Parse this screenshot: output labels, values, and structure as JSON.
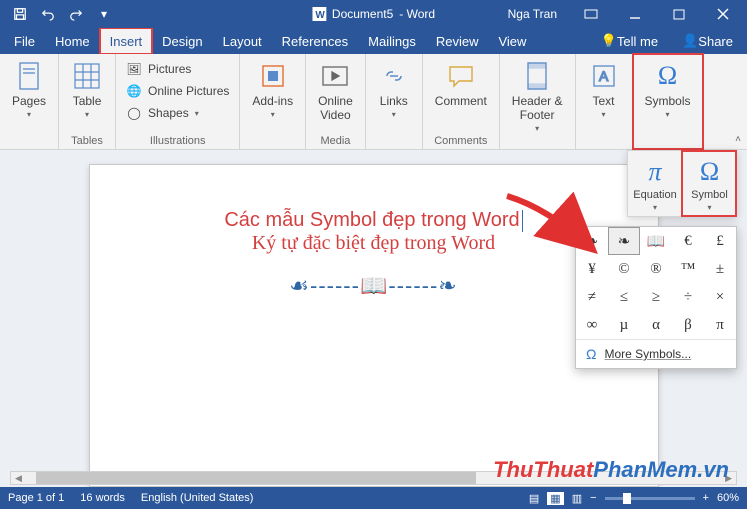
{
  "title": {
    "docname": "Document5",
    "suffix": "- Word",
    "user": "Nga Tran"
  },
  "qat": {
    "save": "save",
    "undo": "undo",
    "redo": "redo",
    "customize": "▾"
  },
  "menu": {
    "tabs": [
      "File",
      "Home",
      "Insert",
      "Design",
      "Layout",
      "References",
      "Mailings",
      "Review",
      "View"
    ],
    "active": "Insert",
    "tellme": "Tell me",
    "share": "Share"
  },
  "ribbon": {
    "pages": {
      "label": "Pages"
    },
    "tables": {
      "btn": "Table",
      "label": "Tables"
    },
    "illustrations": {
      "pictures": "Pictures",
      "online_pictures": "Online Pictures",
      "shapes": "Shapes",
      "label": "Illustrations"
    },
    "addins": {
      "btn": "Add-ins",
      "label": ""
    },
    "media": {
      "btn": "Online\nVideo",
      "label": "Media"
    },
    "links": {
      "btn": "Links"
    },
    "comments": {
      "btn": "Comment",
      "label": "Comments"
    },
    "headerfooter": {
      "btn": "Header &\nFooter"
    },
    "text": {
      "btn": "Text"
    },
    "symbols": {
      "btn": "Symbols"
    }
  },
  "dropdown": {
    "equation": "Equation",
    "symbol": "Symbol"
  },
  "symbol_grid": {
    "rows": [
      [
        "❧",
        "❧",
        "📖",
        "€",
        "£"
      ],
      [
        "¥",
        "©",
        "®",
        "™",
        "±"
      ],
      [
        "≠",
        "≤",
        "≥",
        "÷",
        "×"
      ],
      [
        "∞",
        "µ",
        "α",
        "β",
        "π"
      ]
    ],
    "selected": [
      0,
      1
    ],
    "more": "More Symbols..."
  },
  "doc": {
    "line1": "Các mẫu Symbol đẹp trong Word",
    "line2": "Ký tự đặc biệt đẹp trong Word",
    "dingbats": "☙------📖------❧"
  },
  "status": {
    "page": "Page 1 of 1",
    "words": "16 words",
    "lang": "English (United States)",
    "zoom": "60%"
  },
  "watermark": {
    "a": "ThuThuat",
    "b": "PhanMem",
    "c": ".vn"
  },
  "colors": {
    "accent": "#2b579a",
    "highlight": "#e04040"
  }
}
